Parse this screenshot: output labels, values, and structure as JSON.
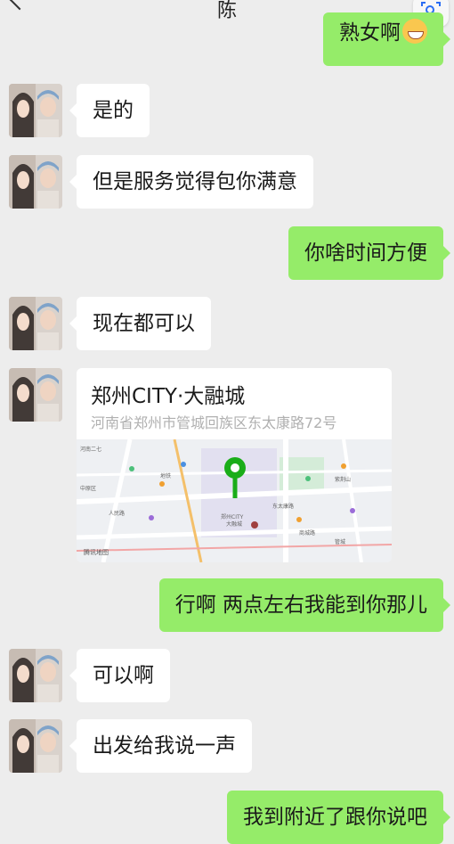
{
  "header": {
    "title": "陈"
  },
  "messages": [
    {
      "side": "out",
      "text": "熟女啊",
      "emoji": "grinning-face-emoji"
    },
    {
      "side": "in",
      "text": "是的"
    },
    {
      "side": "in",
      "text": "但是服务觉得包你满意"
    },
    {
      "side": "out",
      "text": "你啥时间方便"
    },
    {
      "side": "in",
      "text": "现在都可以"
    },
    {
      "side": "in",
      "type": "location",
      "name": "郑州CITY·大融城",
      "address": "河南省郑州市管城回族区东太康路72号"
    },
    {
      "side": "out",
      "text": "行啊 两点左右我能到你那儿"
    },
    {
      "side": "in",
      "text": "可以啊"
    },
    {
      "side": "in",
      "text": "出发给我说一声"
    },
    {
      "side": "out",
      "text": "我到附近了跟你说吧"
    }
  ],
  "map": {
    "labels": [
      "河南二七",
      "中原区",
      "地铁",
      "大融城",
      "郑州CITY",
      "人民路",
      "东太康路",
      "紫荆山",
      "商城路",
      "管城",
      "城东路",
      "未来路"
    ],
    "credit": "腾讯地图",
    "pin_color": "#1aad19"
  },
  "colors": {
    "background": "#ededed",
    "outgoing_bubble": "#95ec69",
    "incoming_bubble": "#ffffff"
  }
}
